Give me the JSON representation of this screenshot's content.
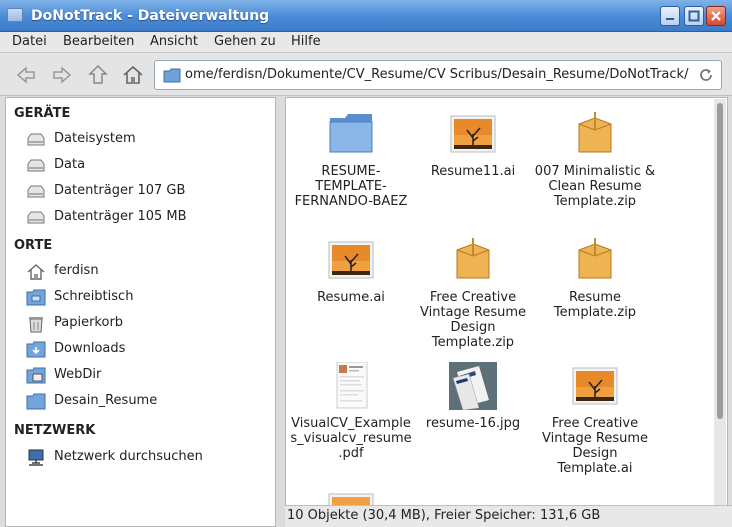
{
  "window": {
    "title": "DoNotTrack - Dateiverwaltung"
  },
  "menu": [
    "Datei",
    "Bearbeiten",
    "Ansicht",
    "Gehen zu",
    "Hilfe"
  ],
  "location": {
    "path": "ome/ferdisn/Dokumente/CV_Resume/CV Scribus/Desain_Resume/DoNotTrack/"
  },
  "sidebar": {
    "devices_header": "GERÄTE",
    "devices": [
      {
        "label": "Dateisystem",
        "icon": "drive-icon"
      },
      {
        "label": "Data",
        "icon": "drive-icon"
      },
      {
        "label": "Datenträger 107 GB",
        "icon": "drive-icon"
      },
      {
        "label": "Datenträger 105 MB",
        "icon": "drive-icon"
      }
    ],
    "places_header": "ORTE",
    "places": [
      {
        "label": "ferdisn",
        "icon": "home-icon"
      },
      {
        "label": "Schreibtisch",
        "icon": "desktop-folder-icon"
      },
      {
        "label": "Papierkorb",
        "icon": "trash-icon"
      },
      {
        "label": "Downloads",
        "icon": "downloads-folder-icon"
      },
      {
        "label": "WebDir",
        "icon": "web-folder-icon"
      },
      {
        "label": "Desain_Resume",
        "icon": "folder-icon"
      }
    ],
    "network_header": "NETZWERK",
    "network": [
      {
        "label": "Netzwerk durchsuchen",
        "icon": "network-icon"
      }
    ]
  },
  "files": [
    {
      "name": "RESUME-TEMPLATE-FERNANDO-BAEZ",
      "icon": "folder-icon"
    },
    {
      "name": "Resume11.ai",
      "icon": "image-icon"
    },
    {
      "name": "007 Minimalistic & Clean Resume Template.zip",
      "icon": "archive-icon"
    },
    {
      "name": "Resume.ai",
      "icon": "image-icon"
    },
    {
      "name": "Free Creative Vintage Resume Design Template.zip",
      "icon": "archive-icon"
    },
    {
      "name": "Resume Template.zip",
      "icon": "archive-icon"
    },
    {
      "name": "VisualCV_Examples_visualcv_resume.pdf",
      "icon": "pdf-thumbnail-icon"
    },
    {
      "name": "resume-16.jpg",
      "icon": "jpg-thumbnail-icon"
    },
    {
      "name": "Free Creative Vintage Resume Design Template.ai",
      "icon": "image-icon"
    }
  ],
  "status": {
    "text": "10 Objekte (30,4 MB), Freier Speicher: 131,6 GB"
  }
}
